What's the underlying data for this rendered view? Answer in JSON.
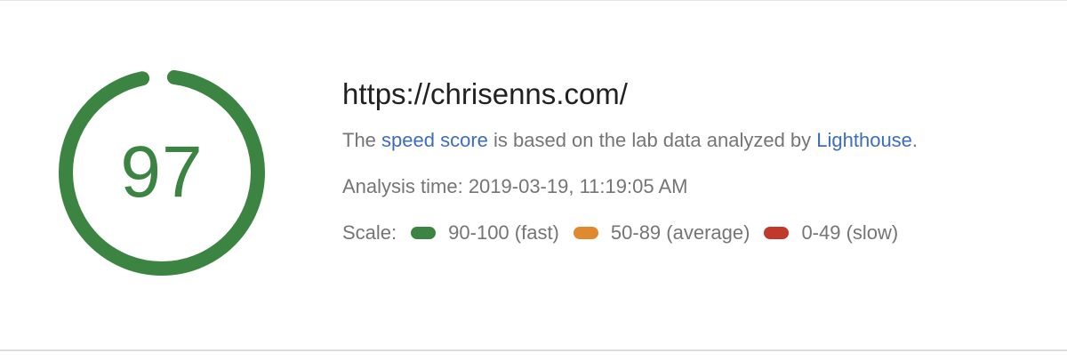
{
  "score": {
    "value": "97",
    "fraction": 0.97,
    "color": "#3b8441"
  },
  "url": "https://chrisenns.com/",
  "description": {
    "part1": "The ",
    "link1": "speed score",
    "part2": " is based on the lab data analyzed by ",
    "link2": "Lighthouse",
    "part3": "."
  },
  "analysis_time": "Analysis time: 2019-03-19, 11:19:05 AM",
  "scale": {
    "label": "Scale:",
    "items": [
      {
        "label": "90-100 (fast)",
        "color": "#3b8441"
      },
      {
        "label": "50-89 (average)",
        "color": "#e08a2e"
      },
      {
        "label": "0-49 (slow)",
        "color": "#c0392b"
      }
    ]
  },
  "colors": {
    "link": "#3c6cc4",
    "text_secondary": "#757575",
    "text_primary": "#212121"
  }
}
